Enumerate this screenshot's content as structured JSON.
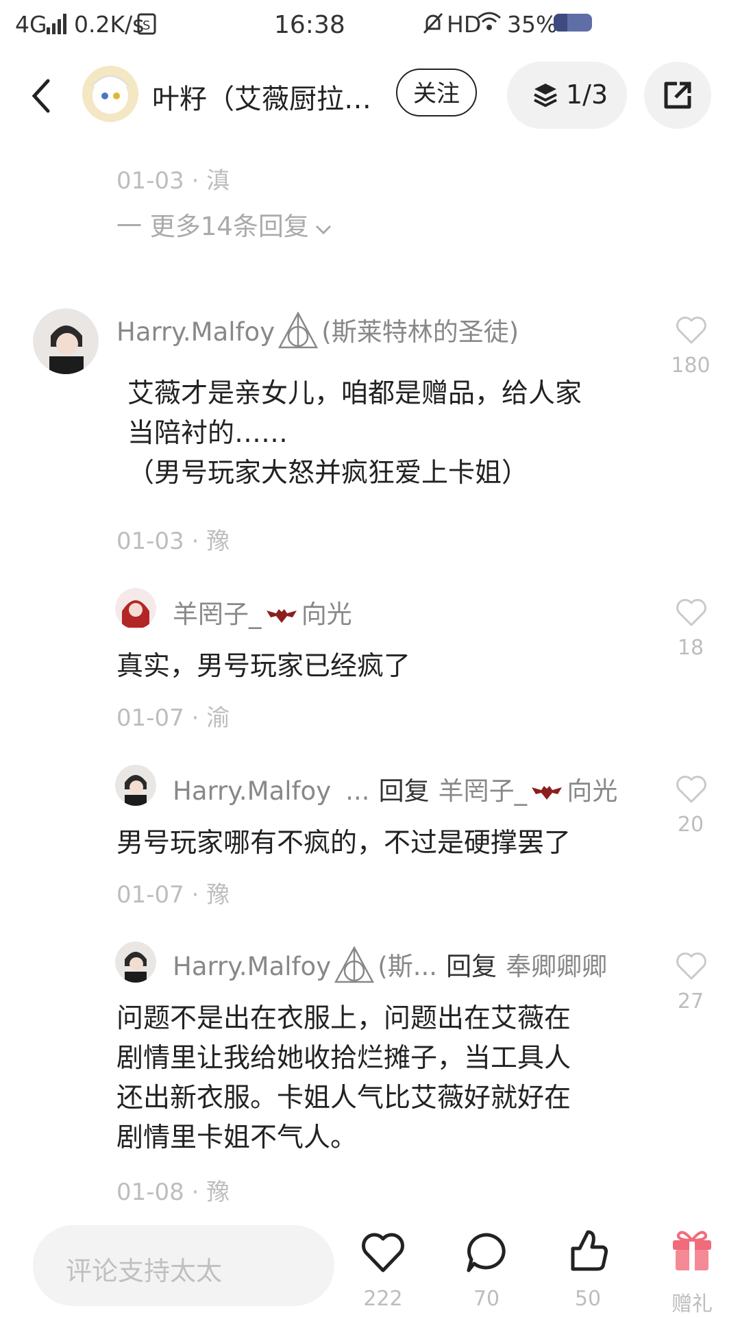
{
  "status": {
    "network": "4G",
    "speed": "0.2K/s",
    "time": "16:38",
    "hd": "HD",
    "battery": "35%"
  },
  "header": {
    "title": "叶籽（艾薇厨拉…",
    "follow_label": "关注",
    "pager": "1/3"
  },
  "thread_top": {
    "meta": "01-03 · 滇",
    "more_replies": "一 更多14条回复"
  },
  "comments": [
    {
      "user": "Harry.Malfoy",
      "user_suffix": "(斯莱特林的圣徒)",
      "lines": [
        "艾薇才是亲女儿，咱都是赠品，给人家",
        "当陪衬的……",
        "（男号玩家大怒并疯狂爱上卡姐）"
      ],
      "meta": "01-03 · 豫",
      "likes": "180"
    }
  ],
  "replies": [
    {
      "user": "羊罔子_",
      "user_tail": "向光",
      "text": "真实，男号玩家已经疯了",
      "meta": "01-07 · 渝",
      "likes": "18"
    },
    {
      "user": "Harry.Malfoy",
      "user_ellipsis": "...",
      "reply_word": "回复",
      "reply_to": "羊罔子_",
      "reply_to_tail": "向光",
      "text": "男号玩家哪有不疯的，不过是硬撑罢了",
      "meta": "01-07 · 豫",
      "likes": "20"
    },
    {
      "user": "Harry.Malfoy",
      "user_suffix": "(斯...",
      "reply_word": "回复",
      "reply_to": "奉卿卿卿",
      "lines": [
        "问题不是出在衣服上，问题出在艾薇在",
        "剧情里让我给她收拾烂摊子，当工具人",
        "还出新衣服。卡姐人气比艾薇好就好在",
        "剧情里卡姐不气人。"
      ],
      "meta": "01-08 · 豫",
      "likes": "27"
    }
  ],
  "bottom": {
    "input_placeholder": "评论支持太太",
    "like_count": "222",
    "comment_count": "70",
    "thumb_count": "50",
    "gift_label": "赠礼"
  },
  "colors": {
    "accent_gift": "#f26b7a",
    "muted": "#bdbdbd"
  }
}
